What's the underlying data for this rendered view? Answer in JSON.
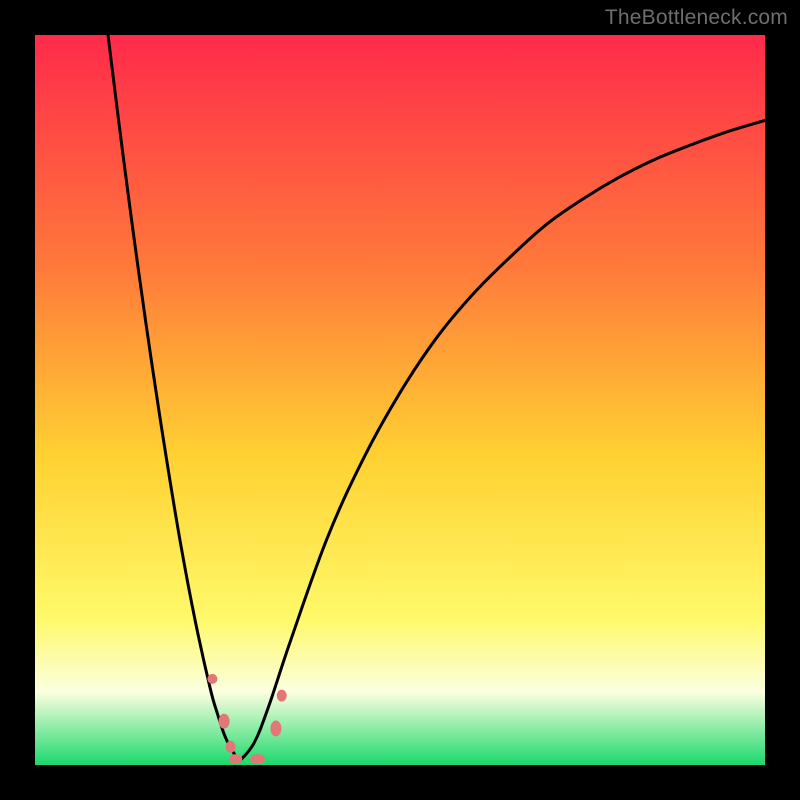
{
  "watermark": "TheBottleneck.com",
  "colors": {
    "gradient_top": "#ff2a4b",
    "gradient_mid_upper": "#ff7a3a",
    "gradient_mid": "#ffd232",
    "gradient_mid_lower": "#fff96a",
    "gradient_band": "#fcffe0",
    "gradient_bottom": "#1bd96c",
    "curve": "#000000",
    "marker_fill": "#e17877",
    "marker_stroke": "#c75957"
  },
  "chart_data": {
    "type": "line",
    "title": "",
    "xlabel": "",
    "ylabel": "",
    "xlim": [
      0,
      100
    ],
    "ylim": [
      0,
      100
    ],
    "minimum_x": 28,
    "left_curve": {
      "name": "left-branch",
      "x": [
        10,
        12,
        14,
        16,
        18,
        20,
        22,
        24,
        25,
        26,
        27,
        28
      ],
      "y": [
        100,
        84,
        69,
        55,
        42,
        30,
        19.5,
        10.5,
        7,
        4,
        2,
        0.5
      ]
    },
    "right_curve": {
      "name": "right-branch",
      "x": [
        28,
        30,
        32,
        35,
        40,
        45,
        50,
        55,
        60,
        65,
        70,
        75,
        80,
        85,
        90,
        95,
        100
      ],
      "y": [
        0.5,
        3,
        8,
        17,
        31,
        42,
        51,
        58.5,
        64.5,
        69.5,
        74,
        77.5,
        80.5,
        83,
        85,
        86.8,
        88.3
      ]
    },
    "markers": [
      {
        "x": 24.3,
        "y": 11.8,
        "rx": 5,
        "ry": 5
      },
      {
        "x": 25.9,
        "y": 6.0,
        "rx": 5.5,
        "ry": 7.5
      },
      {
        "x": 26.8,
        "y": 2.5,
        "rx": 5,
        "ry": 6
      },
      {
        "x": 27.5,
        "y": 0.8,
        "rx": 6.5,
        "ry": 5
      },
      {
        "x": 30.5,
        "y": 0.8,
        "rx": 7.5,
        "ry": 5
      },
      {
        "x": 33.0,
        "y": 5.0,
        "rx": 5.5,
        "ry": 8
      },
      {
        "x": 33.8,
        "y": 9.5,
        "rx": 5,
        "ry": 6
      }
    ]
  }
}
